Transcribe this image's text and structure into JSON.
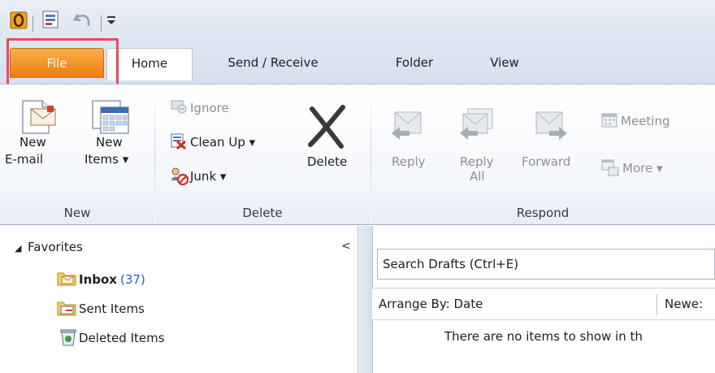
{
  "qat": {
    "icons": [
      "outlook-icon",
      "send-receive-all-icon",
      "undo-icon",
      "customize-qat-icon"
    ]
  },
  "tabs": [
    {
      "label": "File"
    },
    {
      "label": "Home"
    },
    {
      "label": "Send / Receive"
    },
    {
      "label": "Folder"
    },
    {
      "label": "View"
    }
  ],
  "ribbon": {
    "new": {
      "group_label": "New",
      "new_email_line1": "New",
      "new_email_line2": "E-mail",
      "new_items_line1": "New",
      "new_items_line2": "Items ▾"
    },
    "delete": {
      "group_label": "Delete",
      "ignore": "Ignore",
      "clean_up": "Clean Up ▾",
      "junk": "Junk ▾",
      "delete": "Delete"
    },
    "respond": {
      "group_label": "Respond",
      "reply": "Reply",
      "reply_all_line1": "Reply",
      "reply_all_line2": "All",
      "forward": "Forward",
      "meeting": "Meeting",
      "more": "More ▾"
    }
  },
  "nav": {
    "favorites": "Favorites",
    "collapse": "<",
    "items": [
      {
        "label": "Inbox",
        "count": "(37)"
      },
      {
        "label": "Sent Items"
      },
      {
        "label": "Deleted Items"
      }
    ]
  },
  "messages": {
    "search_placeholder": "Search Drafts (Ctrl+E)",
    "arrange_by": "Arrange By: Date",
    "sort": "Newe:",
    "empty": "There are no items to show in th"
  },
  "colors": {
    "file_tab": "#ee7a0e",
    "highlight": "#e84b5b",
    "count": "#1e62c6"
  }
}
